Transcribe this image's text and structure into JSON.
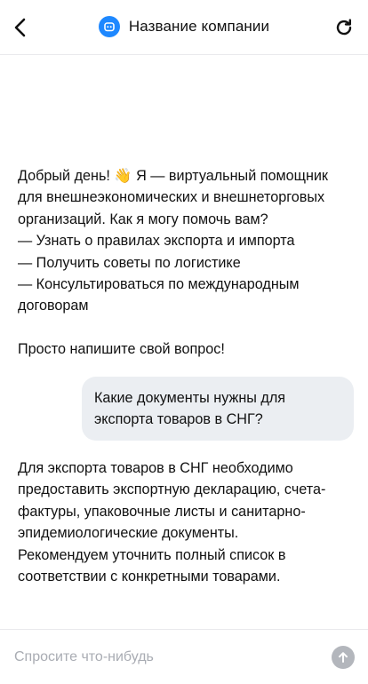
{
  "header": {
    "title": "Название компании",
    "back_icon": "chevron-left-icon",
    "logo_icon": "bot-icon",
    "refresh_icon": "refresh-icon",
    "logo_color": "#1e88ff"
  },
  "messages": {
    "bot_greeting": {
      "lines": [
        "Добрый день! 👋 Я — виртуальный помощник",
        "для внешнеэкономических и внешнеторговых",
        "организаций. Как я могу помочь вам?",
        "— Узнать о правилах экспорта и импорта",
        "— Получить советы по логистике",
        "— Консультироваться по международным",
        "договорам"
      ],
      "closing": "Просто напишите свой вопрос!"
    },
    "user_question": {
      "lines": [
        "Какие документы нужны для",
        "экспорта товаров в СНГ?"
      ],
      "bubble_color": "#ebeef2"
    },
    "bot_answer": {
      "lines": [
        "Для экспорта товаров в СНГ необходимо",
        "предоставить экспортную декларацию, счета-",
        "фактуры, упаковочные листы и санитарно-",
        "эпидемиологические документы.",
        "Рекомендуем уточнить полный список в",
        "соответствии с конкретными товарами."
      ]
    }
  },
  "input": {
    "placeholder": "Спросите что-нибудь",
    "value": "",
    "send_icon": "arrow-up-icon",
    "send_color": "#b3b6bc"
  }
}
